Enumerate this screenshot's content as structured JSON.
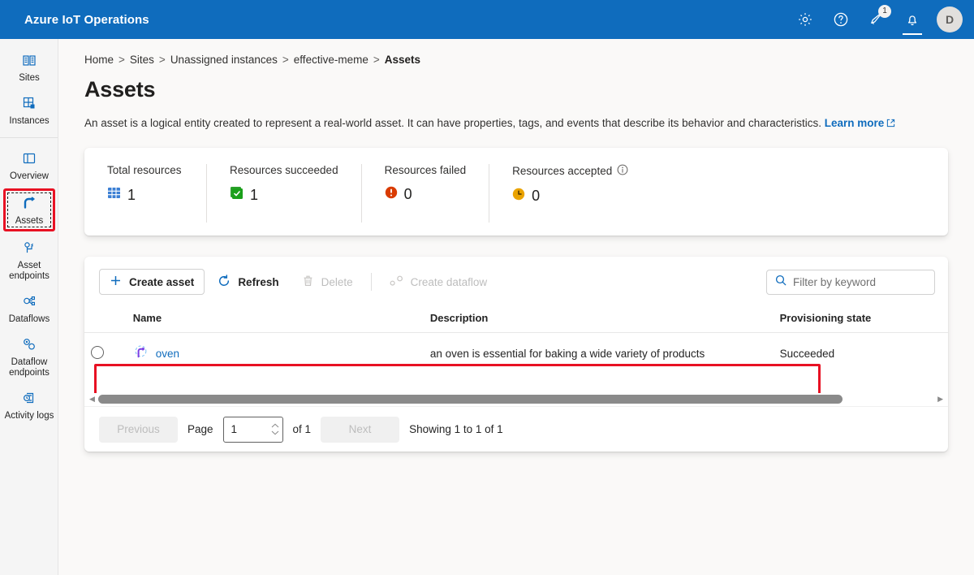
{
  "topbar": {
    "title": "Azure IoT Operations",
    "icons": [
      {
        "name": "settings-icon",
        "label": "Settings"
      },
      {
        "name": "help-icon",
        "label": "Help"
      },
      {
        "name": "feedback-icon",
        "label": "Feedback",
        "badge": "1"
      },
      {
        "name": "notifications-bell-icon",
        "label": "Notifications"
      }
    ],
    "avatar_initial": "D",
    "accent_color": "#0f6cbd"
  },
  "sidebar": {
    "groups": [
      {
        "items": [
          {
            "label": "Sites",
            "icon": "sites-icon",
            "selected": false
          },
          {
            "label": "Instances",
            "icon": "instances-icon",
            "selected": false
          }
        ]
      },
      {
        "items": [
          {
            "label": "Overview",
            "icon": "overview-icon",
            "selected": false
          },
          {
            "label": "Assets",
            "icon": "assets-icon",
            "selected": true
          },
          {
            "label": "Asset endpoints",
            "icon": "asset-endpoints-icon",
            "selected": false
          },
          {
            "label": "Dataflows",
            "icon": "dataflows-icon",
            "selected": false
          },
          {
            "label": "Dataflow endpoints",
            "icon": "dataflow-endpoints-icon",
            "selected": false
          },
          {
            "label": "Activity logs",
            "icon": "activity-logs-icon",
            "selected": false
          }
        ]
      }
    ],
    "highlight_color": "#e81123"
  },
  "breadcrumb": {
    "items": [
      "Home",
      "Sites",
      "Unassigned instances",
      "effective-meme"
    ],
    "current": "Assets",
    "separator": ">"
  },
  "page": {
    "title": "Assets",
    "description": "An asset is a logical entity created to represent a real-world asset. It can have properties, tags, and events that describe its behavior and characteristics.",
    "learn_more": "Learn more"
  },
  "summary": {
    "stats": [
      {
        "label": "Total resources",
        "value": "1",
        "icon": "resource-grid-icon",
        "color": "#0f6cbd",
        "info": false
      },
      {
        "label": "Resources succeeded",
        "value": "1",
        "icon": "success-check-icon",
        "color": "#107c10",
        "info": false
      },
      {
        "label": "Resources failed",
        "value": "0",
        "icon": "error-exclamation-icon",
        "color": "#d83b01",
        "info": false
      },
      {
        "label": "Resources accepted",
        "value": "0",
        "icon": "pending-clock-icon",
        "color": "#eaa300",
        "info": true
      }
    ]
  },
  "toolbar": {
    "create_asset": "Create asset",
    "refresh": "Refresh",
    "delete": "Delete",
    "create_dataflow": "Create dataflow"
  },
  "search": {
    "placeholder": "Filter by keyword",
    "value": ""
  },
  "table": {
    "columns": [
      "Name",
      "Description",
      "Provisioning state"
    ],
    "rows": [
      {
        "name": "oven",
        "icon": "asset-item-icon",
        "description": "an oven is essential for baking a wide variety of products",
        "provisioning_state": "Succeeded",
        "selected": false,
        "highlighted": true
      }
    ]
  },
  "pagination": {
    "previous": "Previous",
    "page_label": "Page",
    "page_value": "1",
    "of_label": "of 1",
    "next": "Next",
    "showing": "Showing 1 to 1 of 1"
  }
}
